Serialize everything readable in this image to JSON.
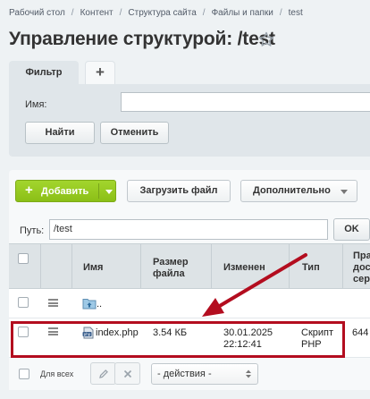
{
  "breadcrumb": [
    "Рабочий стол",
    "Контент",
    "Структура сайта",
    "Файлы и папки",
    "test"
  ],
  "page_title": "Управление структурой: /test",
  "filter": {
    "tab_label": "Фильтр",
    "add_tab_symbol": "+",
    "name_label": "Имя:",
    "name_value": "",
    "find_label": "Найти",
    "cancel_label": "Отменить"
  },
  "toolbar": {
    "add_label": "Добавить",
    "upload_label": "Загрузить файл",
    "more_label": "Дополнительно"
  },
  "path": {
    "label": "Путь:",
    "value": "/test",
    "ok_label": "OK"
  },
  "grid": {
    "columns": {
      "name": "Имя",
      "size": [
        "Размер",
        "файла"
      ],
      "modified": "Изменен",
      "type": "Тип",
      "rights": [
        "Пра",
        "дос",
        "сер"
      ]
    },
    "up_row": {
      "name": ".."
    },
    "rows": [
      {
        "name": "index.php",
        "size": "3.54 КБ",
        "date": "30.01.2025",
        "time": "22:12:41",
        "type_line1": "Скрипт",
        "type_line2": "PHP",
        "rights": "644"
      }
    ]
  },
  "footer": {
    "for_all_label": "Для всех",
    "actions_placeholder": "- действия -"
  },
  "colors": {
    "accent_green": "#8bbf17",
    "highlight_red": "#b30d1f"
  },
  "icons": [
    "star-icon",
    "plus-icon",
    "folder-up-icon",
    "php-file-icon",
    "menu-icon",
    "pencil-icon",
    "close-icon",
    "arrow-annotation"
  ]
}
